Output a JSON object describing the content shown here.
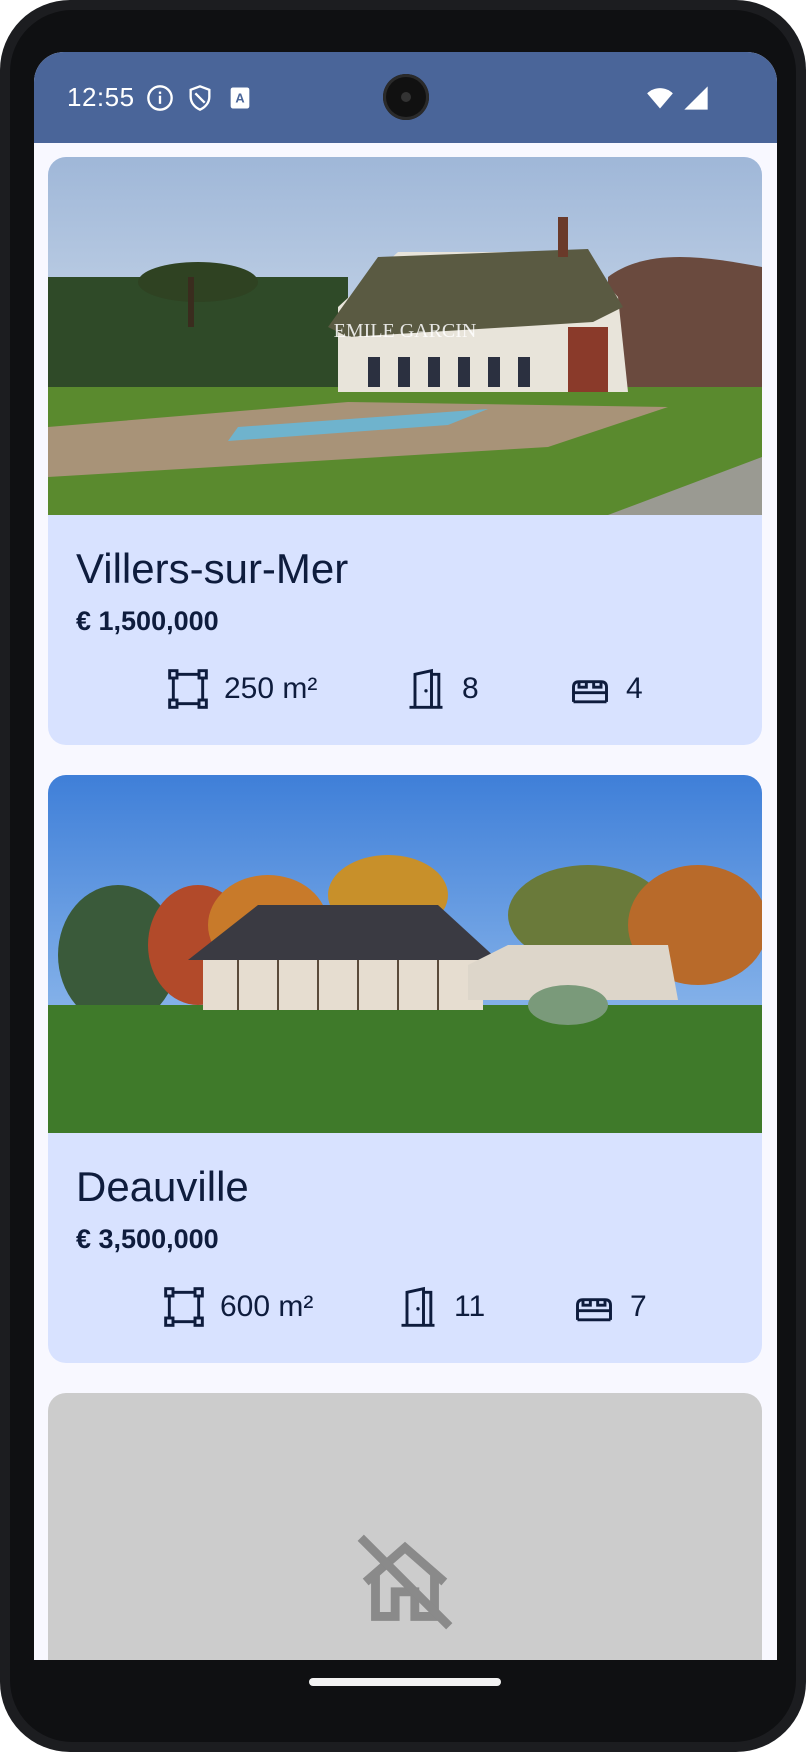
{
  "status_bar": {
    "time": "12:55",
    "left_icons": [
      "info-icon",
      "shield-icon",
      "keyboard-a-icon"
    ],
    "right_icons": [
      "wifi-icon",
      "cell-signal-icon"
    ]
  },
  "listings": [
    {
      "title": "Villers-sur-Mer",
      "price": "€ 1,500,000",
      "area": "250 m²",
      "rooms": "8",
      "bedrooms": "4",
      "image_watermark": "EMILE GARCIN"
    },
    {
      "title": "Deauville",
      "price": "€ 3,500,000",
      "area": "600 m²",
      "rooms": "11",
      "bedrooms": "7"
    },
    {
      "placeholder_icon": "no-home-icon"
    }
  ],
  "colors": {
    "status_bar": "#4a6599",
    "card_background": "#d8e2ff",
    "placeholder_background": "#cccccc",
    "text": "#0e1c3d"
  }
}
